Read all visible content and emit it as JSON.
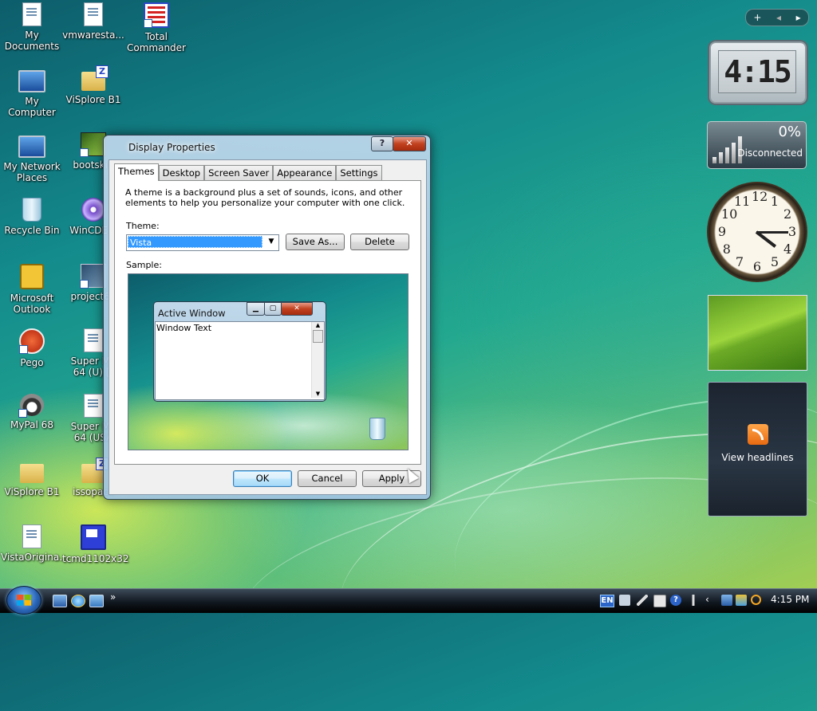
{
  "desktop_icons": [
    {
      "label": "My\nDocuments"
    },
    {
      "label": "vmwaresta..."
    },
    {
      "label": "Total\nCommander"
    },
    {
      "label": "My Computer"
    },
    {
      "label": "ViSplore B1"
    },
    {
      "label": "My Network\nPlaces"
    },
    {
      "label": "bootskin"
    },
    {
      "label": "Recycle Bin"
    },
    {
      "label": "WinCDEm"
    },
    {
      "label": "Microsoft\nOutlook"
    },
    {
      "label": "project64"
    },
    {
      "label": "Pego"
    },
    {
      "label": "Super Ma\n64 (U) [!"
    },
    {
      "label": "MyPal 68"
    },
    {
      "label": "Super Ma\n64 (USA"
    },
    {
      "label": "ViSplore B1"
    },
    {
      "label": "issopack"
    },
    {
      "label": "VistaOrigina..."
    },
    {
      "label": "tcmd1102x32"
    }
  ],
  "sidebar_gadgets": {
    "controls": {
      "add": "+",
      "prev": "◂",
      "next": "▸"
    },
    "digital_clock": {
      "time": "4:15"
    },
    "network_meter": {
      "percent": "0%",
      "status": "Disconnected"
    },
    "analog_clock": {
      "hour": 4,
      "minute": 15,
      "numerals": [
        "12",
        "1",
        "2",
        "3",
        "4",
        "5",
        "6",
        "7",
        "8",
        "9",
        "10",
        "11"
      ]
    },
    "feed_headlines": {
      "label": "View headlines"
    }
  },
  "dialog": {
    "title": "Display Properties",
    "help_label": "?",
    "close_label": "✕",
    "tabs": [
      {
        "label": "Themes",
        "active": true
      },
      {
        "label": "Desktop",
        "active": false
      },
      {
        "label": "Screen Saver",
        "active": false
      },
      {
        "label": "Appearance",
        "active": false
      },
      {
        "label": "Settings",
        "active": false
      }
    ],
    "description": "A theme is a background plus a set of sounds, icons, and other elements to help you personalize your computer with one click.",
    "theme_label": "Theme:",
    "theme_value": "Vista",
    "save_as_label": "Save As...",
    "delete_label": "Delete",
    "sample_label": "Sample:",
    "sample_window": {
      "title": "Active Window",
      "text": "Window Text"
    },
    "ok_label": "OK",
    "cancel_label": "Cancel",
    "apply_label": "Apply"
  },
  "taskbar": {
    "quick_launch_more": "»",
    "language": "EN",
    "clock": "4:15 PM"
  }
}
